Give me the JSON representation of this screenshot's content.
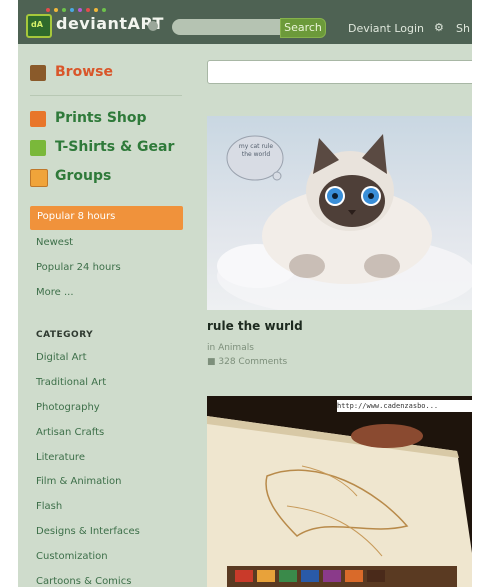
{
  "header": {
    "logo_text": "deviantART",
    "logo_badge": "dA",
    "search_placeholder": "",
    "search_button": "Search",
    "login_text": "Deviant Login",
    "overflow_text": "Sh"
  },
  "sidebar": {
    "primary": [
      {
        "label": "Browse",
        "icon": "browse-icon",
        "color": "#d9562a"
      },
      {
        "label": "Prints Shop",
        "icon": "prints-shop-icon",
        "color": "#2f7a3a"
      },
      {
        "label": "T-Shirts & Gear",
        "icon": "tshirt-icon",
        "color": "#2f7a3a"
      },
      {
        "label": "Groups",
        "icon": "groups-icon",
        "color": "#2f7a3a"
      }
    ],
    "filters": [
      "Popular 8 hours",
      "Newest",
      "Popular 24 hours",
      "More ..."
    ],
    "active_filter_color": "#f0923b",
    "category_heading": "CATEGORY",
    "categories": [
      "Digital Art",
      "Traditional Art",
      "Photography",
      "Artisan Crafts",
      "Literature",
      "Film & Animation",
      "Flash",
      "Designs & Interfaces",
      "Customization",
      "Cartoons & Comics"
    ]
  },
  "main": {
    "search_value": "",
    "deviations": [
      {
        "title": "rule the wurld",
        "category": "in Animals",
        "comments": "328 Comments",
        "image": "cat-artwork",
        "speech_text": "my cat rule the world"
      },
      {
        "title": "",
        "image": "sketch-artwork",
        "url_overlay": "http://www.cadenzasbo..."
      }
    ]
  },
  "colors": {
    "topbar": "#4e6253",
    "sidebar_bg": "#cfdccc",
    "accent_orange": "#f0923b",
    "search_green": "#6c9a3a"
  }
}
